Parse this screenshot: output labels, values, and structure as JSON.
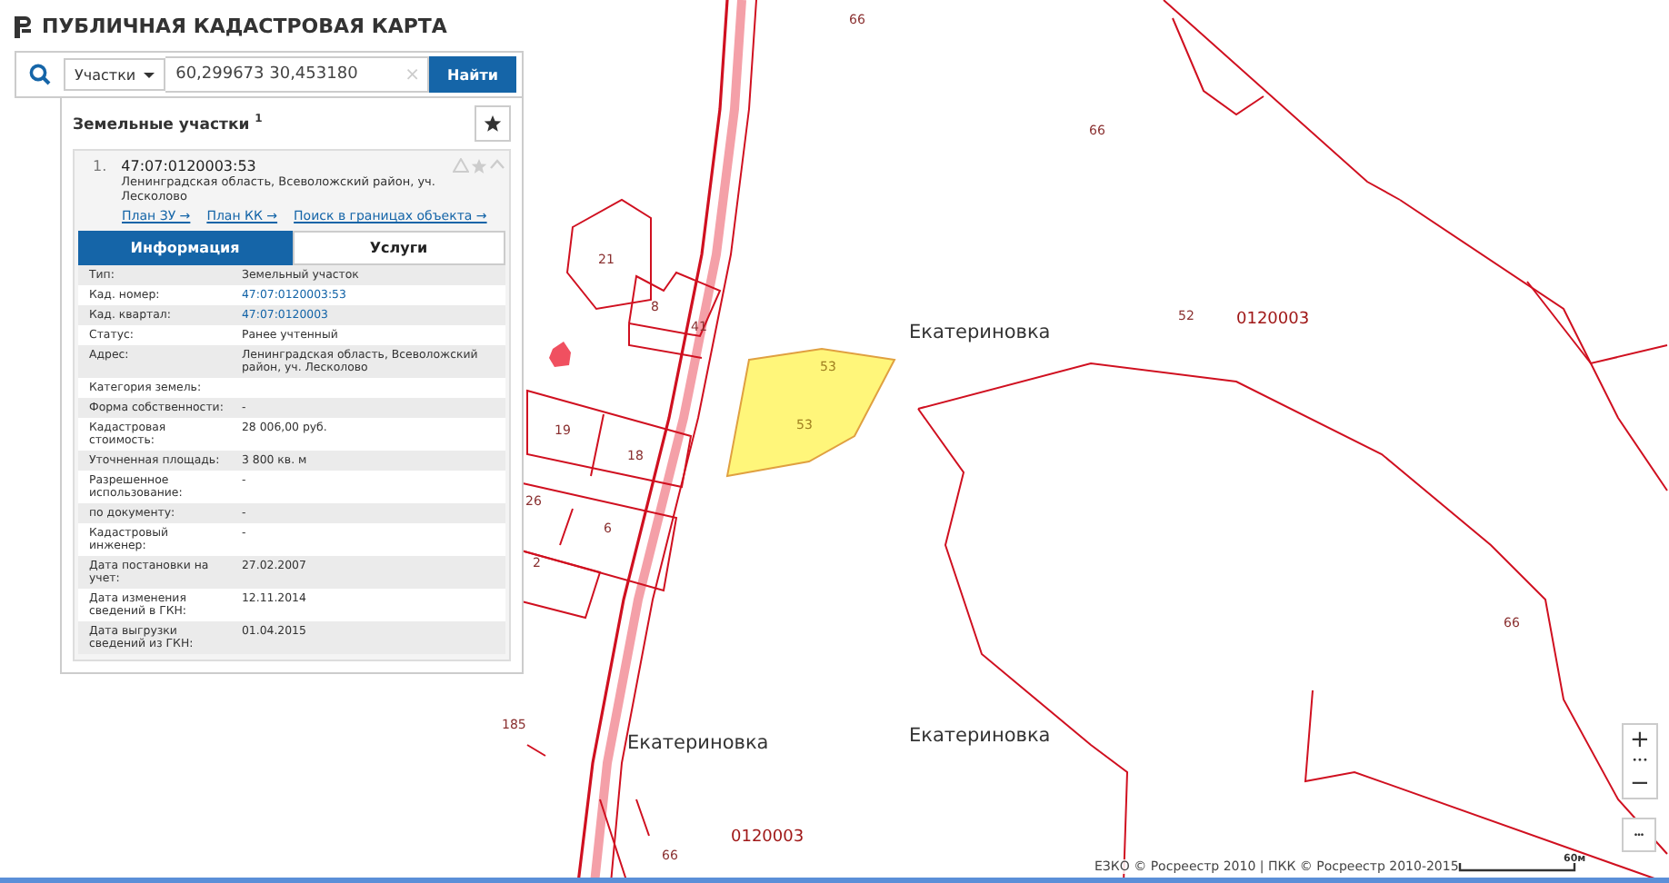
{
  "header": {
    "title": "ПУБЛИЧНАЯ КАДАСТРОВАЯ КАРТА"
  },
  "search": {
    "category": "Участки",
    "value": "60,299673 30,453180",
    "clear": "×",
    "button": "Найти"
  },
  "results": {
    "title": "Земельные участки",
    "count": "1",
    "items": [
      {
        "number": "1.",
        "cadastral": "47:07:0120003:53",
        "address": "Ленинградская область, Всеволожский район, уч. Лесколово",
        "expanded": true,
        "links": [
          "План ЗУ →",
          "План КК →",
          "Поиск в границах объекта →"
        ],
        "tabs": [
          {
            "label": "Информация",
            "selected": true
          },
          {
            "label": "Услуги",
            "selected": false
          }
        ],
        "fields": [
          {
            "label": "Тип:",
            "value": "Земельный участок",
            "link": false
          },
          {
            "label": "Кад. номер:",
            "value": "47:07:0120003:53",
            "link": true
          },
          {
            "label": "Кад. квартал:",
            "value": "47:07:0120003",
            "link": true
          },
          {
            "label": "Статус:",
            "value": "Ранее учтенный",
            "link": false
          },
          {
            "label": "Адрес:",
            "value": "Ленинградская область, Всеволожский район, уч. Лесколово",
            "link": false
          },
          {
            "label": "Категория земель:",
            "link": false
          },
          {
            "label": "Форма собственности:",
            "value": "-",
            "link": false
          },
          {
            "label": "Кадастровая стоимость:",
            "value": "28 006,00 руб.",
            "link": false
          },
          {
            "label": "Уточненная площадь:",
            "value": "3 800 кв. м",
            "link": false
          },
          {
            "label": "Разрешенное использование:",
            "value": "-",
            "link": false
          },
          {
            "label": "по документу:",
            "value": "-",
            "link": false
          },
          {
            "label": "Кадастровый инженер:",
            "value": "-",
            "link": false
          },
          {
            "label": "Дата постановки на учет:",
            "value": "27.02.2007",
            "link": false
          },
          {
            "label": "Дата изменения сведений в ГКН:",
            "value": "12.11.2014",
            "link": false
          },
          {
            "label": "Дата выгрузки сведений из ГКН:",
            "value": "01.04.2015",
            "link": false
          }
        ]
      }
    ]
  },
  "map": {
    "labels": [
      {
        "text": "66",
        "kind": "parcel"
      },
      {
        "text": "66",
        "kind": "parcel"
      },
      {
        "text": "21",
        "kind": "parcel"
      },
      {
        "text": "8",
        "kind": "parcel"
      },
      {
        "text": "41",
        "kind": "parcel"
      },
      {
        "text": "53",
        "kind": "selected"
      },
      {
        "text": "53",
        "kind": "selected"
      },
      {
        "text": "19",
        "kind": "parcel"
      },
      {
        "text": "18",
        "kind": "parcel"
      },
      {
        "text": "26",
        "kind": "parcel"
      },
      {
        "text": "6",
        "kind": "parcel"
      },
      {
        "text": "2",
        "kind": "parcel"
      },
      {
        "text": "52",
        "kind": "parcel"
      },
      {
        "text": "0120003",
        "kind": "quarter"
      },
      {
        "text": "66",
        "kind": "parcel"
      },
      {
        "text": "185",
        "kind": "parcel"
      },
      {
        "text": "0120003",
        "kind": "quarter"
      },
      {
        "text": "66",
        "kind": "parcel"
      },
      {
        "text": "Екатериновка",
        "kind": "locality"
      },
      {
        "text": "Екатериновка",
        "kind": "locality"
      },
      {
        "text": "Екатериновка",
        "kind": "locality"
      }
    ],
    "controls": {
      "zoom_in": "+",
      "zoom_dots": "•••",
      "zoom_out": "−",
      "more": "•••"
    },
    "attribution": "ЕЗКО © Росреестр 2010 | ПКК © Росреестр 2010-2015",
    "scale": "60м"
  }
}
